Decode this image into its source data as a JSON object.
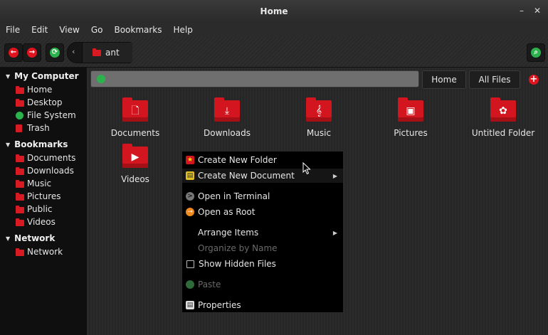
{
  "window": {
    "title": "Home",
    "minimize_glyph": "–",
    "close_glyph": "✕"
  },
  "menubar": {
    "items": [
      "File",
      "Edit",
      "View",
      "Go",
      "Bookmarks",
      "Help"
    ]
  },
  "toolbar": {
    "back_icon": "back-arrow-icon",
    "forward_icon": "forward-arrow-icon",
    "reload_icon": "reload-icon",
    "path_chevron": "‹",
    "breadcrumb": "ant",
    "search_icon": "search-icon"
  },
  "sidebar": {
    "sections": [
      {
        "label": "My Computer",
        "items": [
          "Home",
          "Desktop",
          "File System",
          "Trash"
        ]
      },
      {
        "label": "Bookmarks",
        "items": [
          "Documents",
          "Downloads",
          "Music",
          "Pictures",
          "Public",
          "Videos"
        ]
      },
      {
        "label": "Network",
        "items": [
          "Network"
        ]
      }
    ]
  },
  "location": {
    "home_button": "Home",
    "all_files_button": "All Files",
    "add_glyph": "+"
  },
  "files": [
    {
      "name": "Documents",
      "icon": "document-icon",
      "glyph": "🗋"
    },
    {
      "name": "Downloads",
      "icon": "download-icon",
      "glyph": "⤓"
    },
    {
      "name": "Music",
      "icon": "music-icon",
      "glyph": "𝄞"
    },
    {
      "name": "Pictures",
      "icon": "picture-icon",
      "glyph": "▣"
    },
    {
      "name": "Untitled Folder",
      "icon": "gnome-icon",
      "glyph": "✿"
    },
    {
      "name": "Videos",
      "icon": "play-icon",
      "glyph": "▶"
    }
  ],
  "context_menu": {
    "items": [
      {
        "label": "Create New Folder",
        "icon": "new-folder-icon",
        "submenu": false,
        "disabled": false
      },
      {
        "label": "Create New Document",
        "icon": "new-document-icon",
        "submenu": true,
        "disabled": false
      },
      {
        "label": "Open in Terminal",
        "icon": "terminal-icon",
        "submenu": false,
        "disabled": false
      },
      {
        "label": "Open as Root",
        "icon": "root-key-icon",
        "submenu": false,
        "disabled": false
      },
      {
        "label": "Arrange Items",
        "icon": "",
        "submenu": true,
        "disabled": false
      },
      {
        "label": "Organize by Name",
        "icon": "",
        "submenu": false,
        "disabled": true
      },
      {
        "label": "Show Hidden Files",
        "icon": "checkbox-icon",
        "submenu": false,
        "disabled": false
      },
      {
        "label": "Paste",
        "icon": "paste-icon",
        "submenu": false,
        "disabled": true
      },
      {
        "label": "Properties",
        "icon": "properties-icon",
        "submenu": false,
        "disabled": false
      }
    ]
  },
  "colors": {
    "accent": "#e0141e",
    "green": "#2bb24c"
  }
}
